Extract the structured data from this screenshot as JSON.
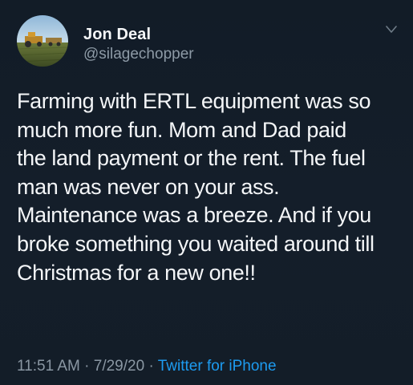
{
  "author": {
    "display_name": "Jon Deal",
    "handle": "@silagechopper",
    "avatar_icon": "avatar-photo-tractor-field"
  },
  "menu_icon": "chevron-down-icon",
  "tweet": {
    "text": "Farming with ERTL equipment was so\nmuch more fun.  Mom and Dad paid\nthe land payment or the rent. The fuel\nman was never on your ass.\nMaintenance was a breeze. And if you\nbroke something you waited around till\nChristmas for a new one!!"
  },
  "meta": {
    "time": "11:51 AM",
    "separator1": " · ",
    "date": "7/29/20",
    "separator2": " · ",
    "source": "Twitter for iPhone"
  },
  "colors": {
    "background": "#15202b",
    "link": "#1d9bf0",
    "secondary_text": "#8d9aa6"
  }
}
